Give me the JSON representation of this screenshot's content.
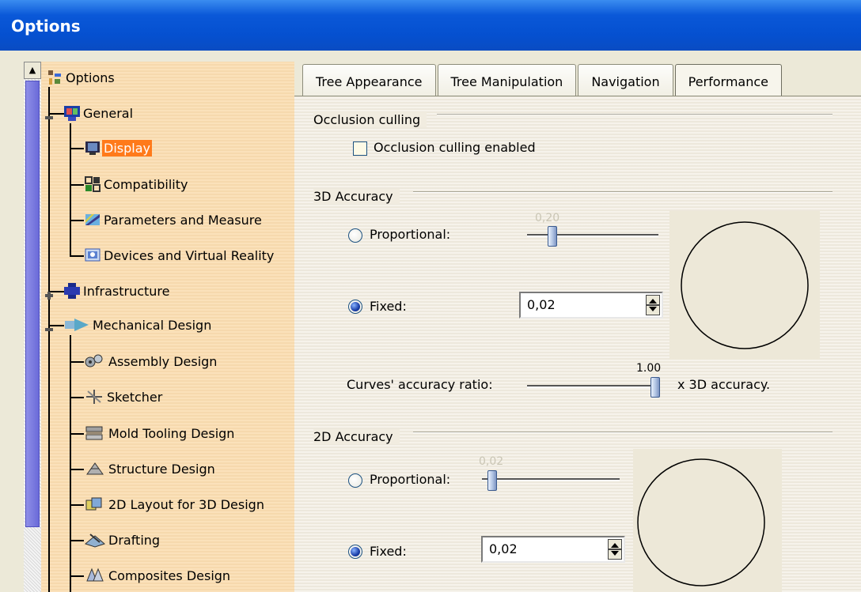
{
  "window": {
    "title": "Options"
  },
  "tree": {
    "items": [
      {
        "label": "Options",
        "icon": "options-tree-icon"
      },
      {
        "label": "General",
        "icon": "general-icon"
      },
      {
        "label": "Display",
        "icon": "display-icon",
        "selected": true
      },
      {
        "label": "Compatibility",
        "icon": "compatibility-icon"
      },
      {
        "label": "Parameters and Measure",
        "icon": "parameters-icon"
      },
      {
        "label": "Devices and Virtual Reality",
        "icon": "devices-icon"
      },
      {
        "label": "Infrastructure",
        "icon": "infrastructure-icon"
      },
      {
        "label": "Mechanical Design",
        "icon": "mechanical-design-icon"
      },
      {
        "label": "Assembly Design",
        "icon": "assembly-icon"
      },
      {
        "label": "Sketcher",
        "icon": "sketcher-icon"
      },
      {
        "label": "Mold Tooling Design",
        "icon": "mold-icon"
      },
      {
        "label": "Structure Design",
        "icon": "structure-icon"
      },
      {
        "label": "2D Layout for 3D Design",
        "icon": "layout-icon"
      },
      {
        "label": "Drafting",
        "icon": "drafting-icon"
      },
      {
        "label": "Composites Design",
        "icon": "composites-icon"
      }
    ]
  },
  "tabs": [
    {
      "label": "Tree Appearance"
    },
    {
      "label": "Tree Manipulation"
    },
    {
      "label": "Navigation"
    },
    {
      "label": "Performance",
      "active": true
    }
  ],
  "occlusion": {
    "title": "Occlusion culling",
    "checkbox_label": "Occlusion culling enabled",
    "checked": false
  },
  "accuracy3d": {
    "title": "3D Accuracy",
    "proportional_label": "Proportional:",
    "proportional_value": "0,20",
    "fixed_label": "Fixed:",
    "fixed_value": "0,02",
    "selected": "fixed",
    "curves_label": "Curves' accuracy ratio:",
    "curves_value": "1.00",
    "curves_suffix": "x 3D accuracy."
  },
  "accuracy2d": {
    "title": "2D Accuracy",
    "proportional_label": "Proportional:",
    "proportional_value": "0,02",
    "fixed_label": "Fixed:",
    "fixed_value": "0,02",
    "selected": "fixed"
  },
  "colors": {
    "titlebar": "#0550d0",
    "tree_bg": "#fbddb0",
    "selected": "#ff7a1a",
    "panel_bg": "#f1ece0"
  }
}
